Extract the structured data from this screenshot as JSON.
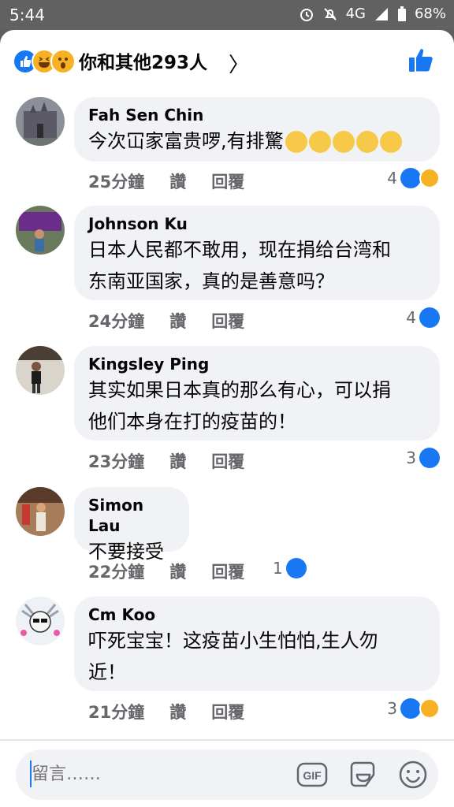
{
  "status": {
    "time": "5:44",
    "network": "4G",
    "battery": "68%"
  },
  "header": {
    "title": "你和其他293人",
    "chevron": "〉"
  },
  "comments": [
    {
      "author": "Fah Sen Chin",
      "text": "今次冚家富贵啰,有排驚",
      "time": "25分鐘",
      "like": "讚",
      "reply": "回覆",
      "reactions": "4"
    },
    {
      "author": "Johnson Ku",
      "text_lines": [
        "日本人民都不敢用，现在捐给台湾和",
        "东南亚国家，真的是善意吗？"
      ],
      "time": "24分鐘",
      "like": "讚",
      "reply": "回覆",
      "reactions": "4"
    },
    {
      "author": "Kingsley Ping",
      "text_lines": [
        "其实如果日本真的那么有心，可以捐",
        "他们本身在打的疫苗的！"
      ],
      "time": "23分鐘",
      "like": "讚",
      "reply": "回覆",
      "reactions": "3"
    },
    {
      "author": "Simon Lau",
      "text": "不要接受",
      "time": "22分鐘",
      "like": "讚",
      "reply": "回覆",
      "reactions": "1"
    },
    {
      "author": "Cm Koo",
      "text_lines": [
        "吓死宝宝！这疫苗小生怕怕,生人勿",
        "近！"
      ],
      "time": "21分鐘",
      "like": "讚",
      "reply": "回覆",
      "reactions": "3"
    }
  ],
  "composer": {
    "placeholder": "留言……",
    "gif_label": "GIF"
  },
  "colors": {
    "accent": "#1877f2",
    "bubble": "#f0f2f5",
    "haha": "#f7b125"
  }
}
